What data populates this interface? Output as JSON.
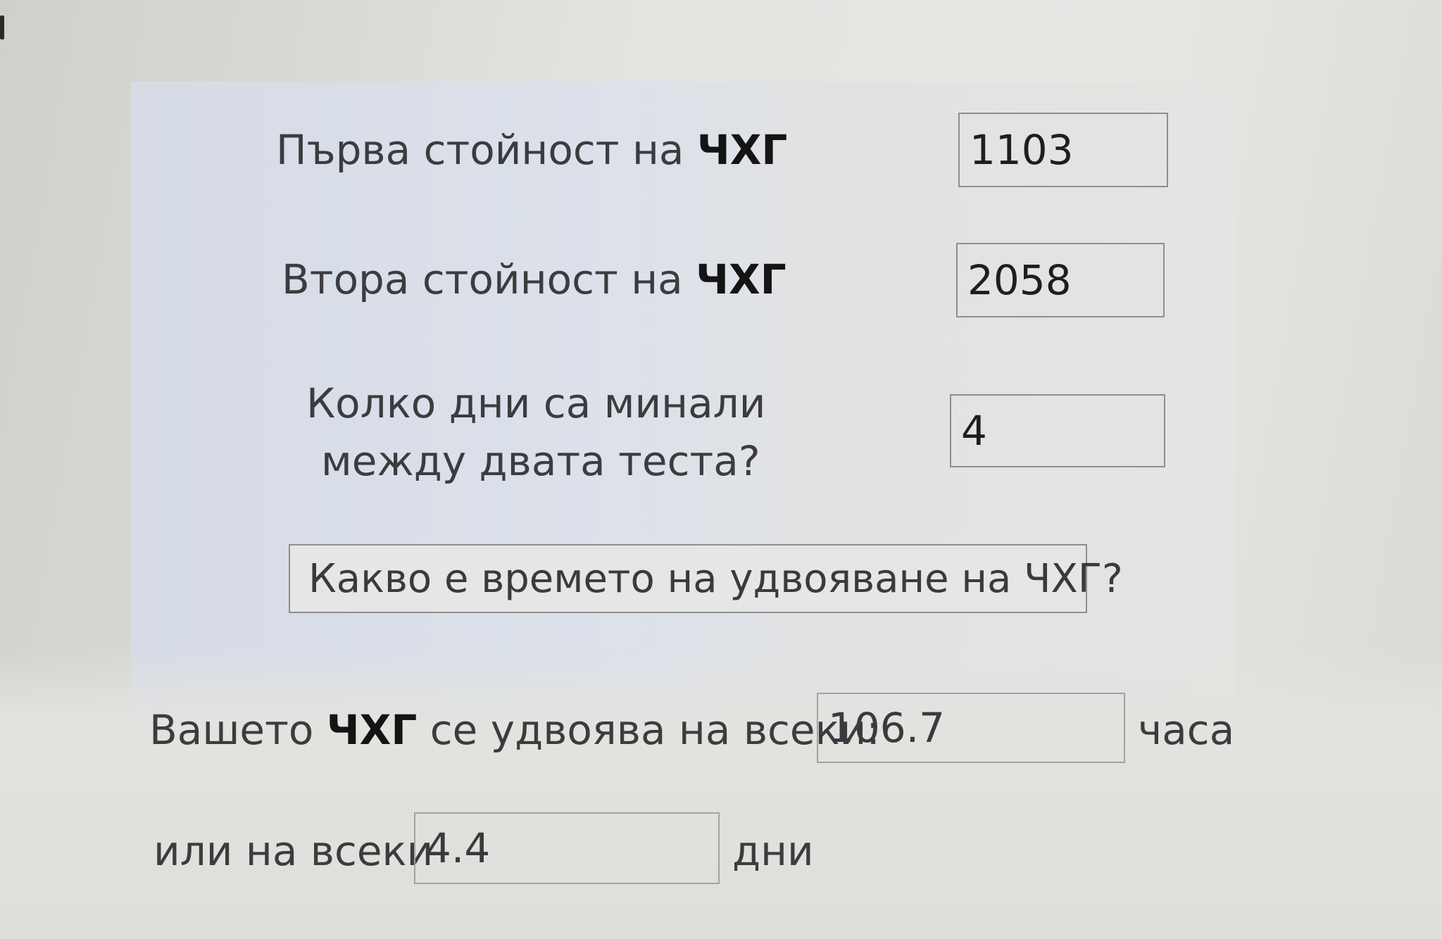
{
  "form": {
    "first_value": {
      "label_prefix": "Първа стойност на",
      "label_bold": "ЧХГ",
      "value": "1103"
    },
    "second_value": {
      "label_prefix": "Втора стойност на",
      "label_bold": "ЧХГ",
      "value": "2058"
    },
    "days_between": {
      "label_line1": "Колко дни са минали",
      "label_line2": "между двата теста?",
      "value": "4"
    },
    "calculate_button_label": "Какво е времето на удвояване на ЧХГ?"
  },
  "result": {
    "hours_line": {
      "prefix": "Вашето",
      "bold": "ЧХГ",
      "suffix": "се удвоява на всеки:",
      "value": "106.7",
      "unit": "часа"
    },
    "days_line": {
      "prefix": "или на всеки",
      "value": "4.4",
      "unit": "дни"
    }
  }
}
